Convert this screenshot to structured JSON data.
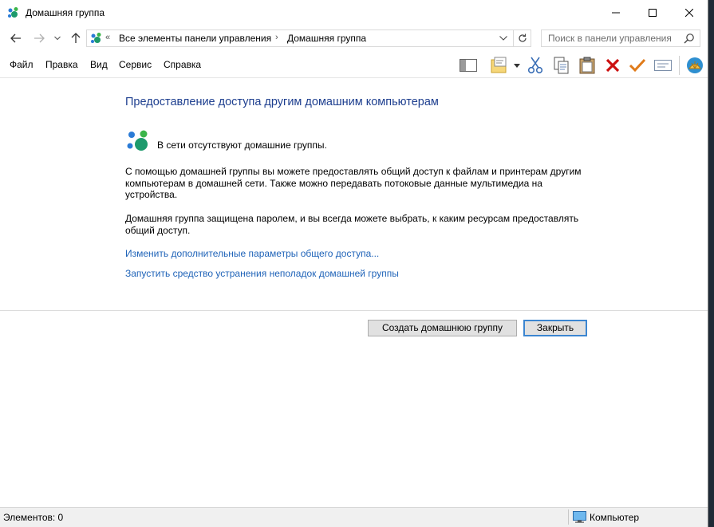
{
  "window": {
    "title": "Домашняя группа"
  },
  "address": {
    "chevron": "«",
    "crumbs": [
      "Все элементы панели управления",
      "Домашняя группа"
    ],
    "separator": "›"
  },
  "search": {
    "placeholder": "Поиск в панели управления"
  },
  "menu": [
    "Файл",
    "Правка",
    "Вид",
    "Сервис",
    "Справка"
  ],
  "toolbar_icons": [
    "layout-pane-icon",
    "properties-icon",
    "cut-icon",
    "copy-icon",
    "paste-icon",
    "delete-icon",
    "check-icon",
    "rename-icon",
    "shell-icon"
  ],
  "content": {
    "heading": "Предоставление доступа другим домашним компьютерам",
    "status": "В сети отсутствуют домашние группы.",
    "para1": "С помощью домашней группы вы можете предоставлять общий доступ к файлам и принтерам другим компьютерам в домашней сети. Также можно передавать потоковые данные мультимедиа на устройства.",
    "para2": "Домашняя группа защищена паролем, и вы всегда можете выбрать, к каким ресурсам предоставлять общий доступ.",
    "link1": "Изменить дополнительные параметры общего доступа...",
    "link2": "Запустить средство устранения неполадок домашней группы"
  },
  "buttons": {
    "create": "Создать домашнюю группу",
    "close": "Закрыть"
  },
  "statusbar": {
    "items": "Элементов: 0",
    "location": "Компьютер"
  },
  "colors": {
    "heading": "#1e3f8f",
    "link": "#1f63b8",
    "focus": "#3c86d1",
    "delete": "#cc1010",
    "check": "#e07b1a"
  }
}
